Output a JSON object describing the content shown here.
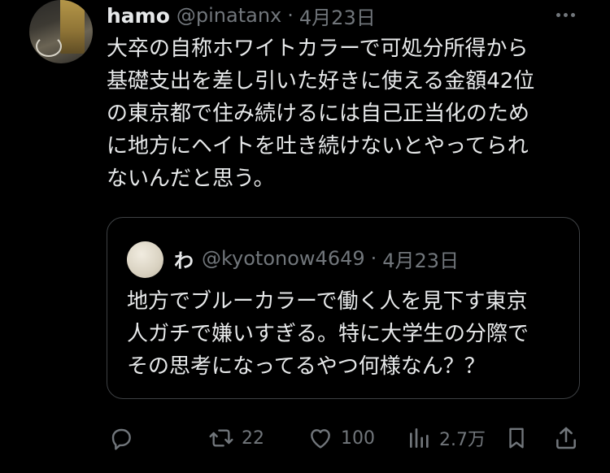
{
  "post": {
    "author_name": "hamo",
    "author_handle": "@pinatanx",
    "separator": "·",
    "date": "4月23日",
    "text_lines": [
      "大卒の自称ホワイトカラーで可処分所得から",
      "基礎支出を差し引いた好きに使える金額42位",
      "の東京都で住み続けるには自己正当化のため",
      "に地方にヘイトを吐き続けないとやってられ",
      "ないんだと思う。"
    ]
  },
  "quoted": {
    "author_name": "わ",
    "author_handle": "@kyotonow4649",
    "separator": "·",
    "date": "4月23日",
    "text_lines": [
      "地方でブルーカラーで働く人を見下す東京",
      "人ガチで嫌いすぎる。特に大学生の分際で",
      "その思考になってるやつ何様なん？？"
    ]
  },
  "actions": {
    "reply": {
      "icon": "reply-icon",
      "count": ""
    },
    "repost": {
      "icon": "repost-icon",
      "count": "22"
    },
    "like": {
      "icon": "heart-icon",
      "count": "100"
    },
    "views": {
      "icon": "views-icon",
      "count": "2.7万"
    },
    "bookmark": {
      "icon": "bookmark-icon"
    },
    "share": {
      "icon": "share-icon"
    }
  },
  "colors": {
    "background": "#000000",
    "text_primary": "#e7e9ea",
    "text_secondary": "#71767b",
    "border": "#3e4144"
  }
}
